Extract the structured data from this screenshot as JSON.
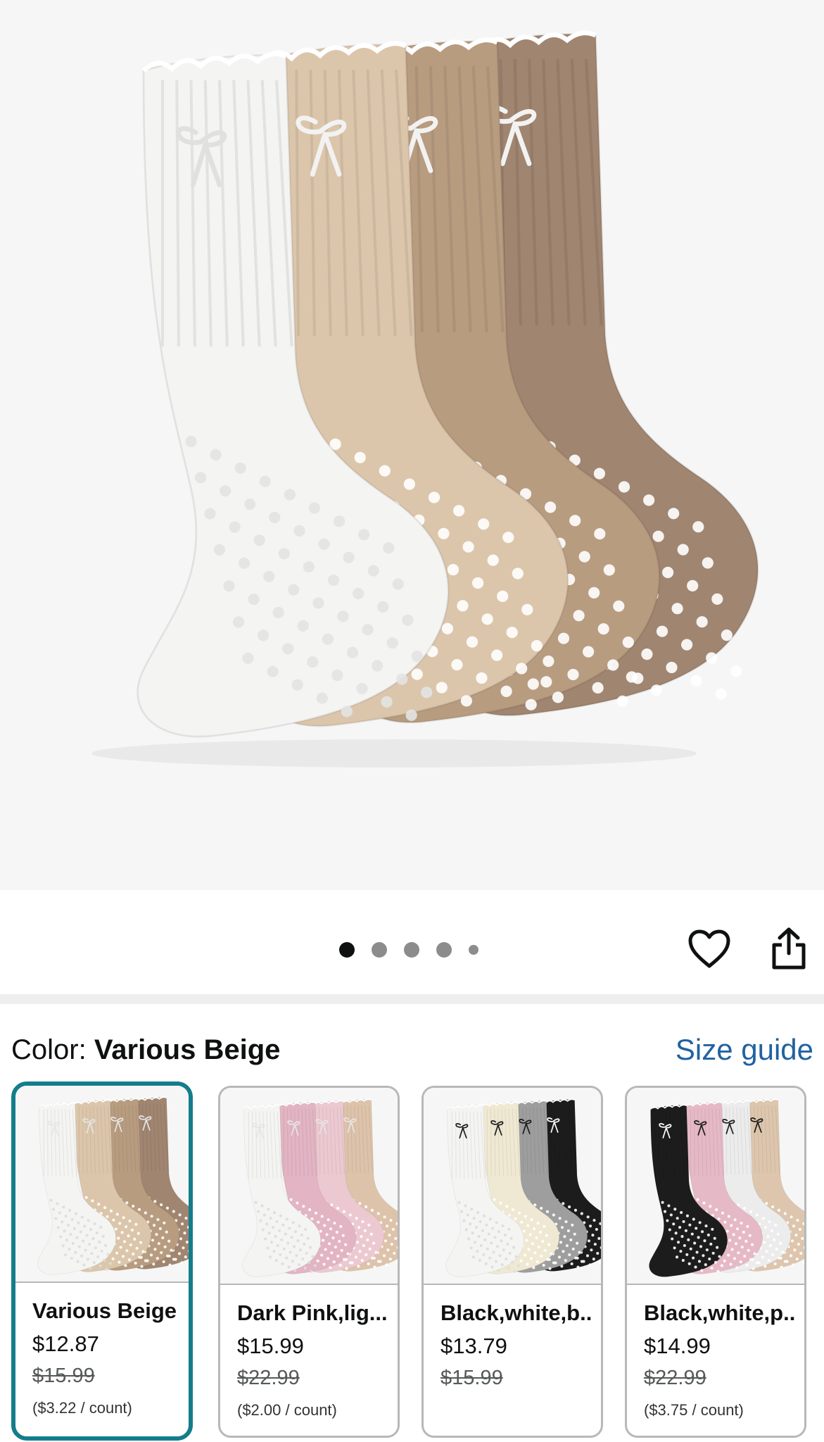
{
  "product_image": {
    "alt": "",
    "sock_colors": [
      "#f4f4f3",
      "#dcc6ab",
      "#b89c80",
      "#a08570"
    ],
    "grip_dot_color": "#ffffff"
  },
  "carousel": {
    "pages": 5,
    "active_index": 0
  },
  "actions": {
    "favorite_icon": "heart-icon",
    "share_icon": "share-icon"
  },
  "color_selector": {
    "label": "Color:",
    "selected_value": "Various Beige",
    "size_guide_link": "Size guide"
  },
  "swatches": [
    {
      "name": "Various Beige",
      "price": "$12.87",
      "list_price": "$15.99",
      "unit_price": "($3.22 / count)",
      "selected": true,
      "colors": [
        "#f4f4f3",
        "#dcc6ab",
        "#b89c80",
        "#a08570"
      ]
    },
    {
      "name": "Dark Pink,lig...",
      "price": "$15.99",
      "list_price": "$22.99",
      "unit_price": "($2.00 / count)",
      "selected": false,
      "colors": [
        "#f4f4f3",
        "#e2b4c4",
        "#ecc9d1",
        "#ddc3aa"
      ]
    },
    {
      "name": "Black,white,b...",
      "price": "$13.79",
      "list_price": "$15.99",
      "unit_price": "",
      "selected": false,
      "colors": [
        "#f4f4f3",
        "#efe9d3",
        "#9e9e9e",
        "#1c1c1c"
      ]
    },
    {
      "name": "Black,white,p...",
      "price": "$14.99",
      "list_price": "$22.99",
      "unit_price": "($3.75 / count)",
      "selected": false,
      "colors": [
        "#1c1c1c",
        "#e6b9c6",
        "#ececec",
        "#ddc6ad"
      ]
    }
  ],
  "theme": {
    "accent_selected_border": "#137d8c",
    "link_color": "#2162a1"
  }
}
